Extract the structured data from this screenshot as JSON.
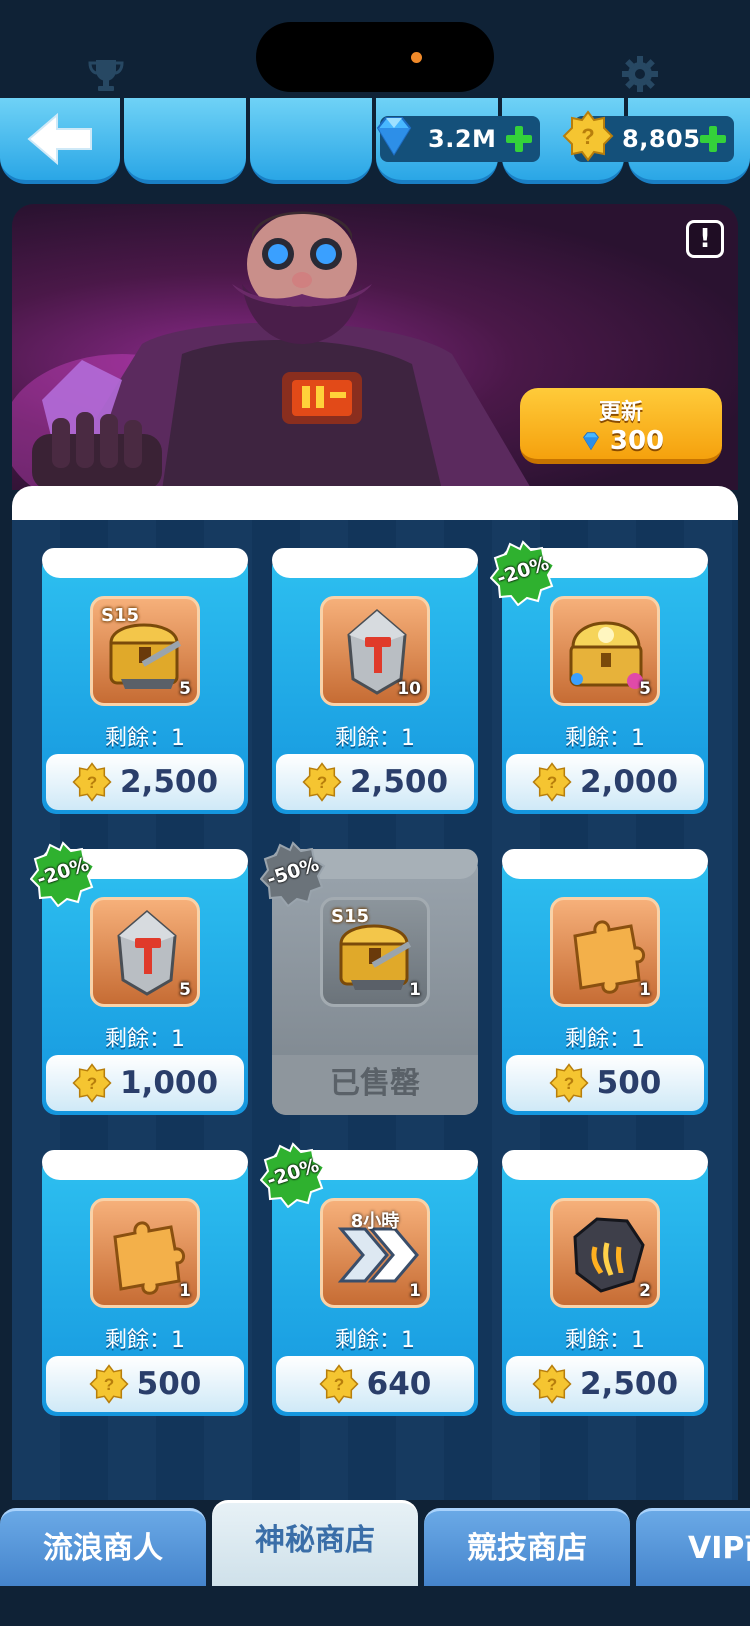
{
  "top_bar": {
    "gems": "3.2M",
    "coins": "8,805"
  },
  "banner": {
    "info_label": "!",
    "refresh_label": "更新",
    "refresh_cost": "300"
  },
  "shop_items": [
    {
      "icon": "s15-chest-icon",
      "badge": "S15",
      "qty": "5",
      "remaining": "剩餘：1",
      "price": "2,500",
      "discount": "",
      "sold_out": false
    },
    {
      "icon": "hammer-stone-icon",
      "badge": "",
      "qty": "10",
      "remaining": "剩餘：1",
      "price": "2,500",
      "discount": "",
      "sold_out": false
    },
    {
      "icon": "treasure-chest-icon",
      "badge": "",
      "qty": "5",
      "remaining": "剩餘：1",
      "price": "2,000",
      "discount": "-20%",
      "sold_out": false
    },
    {
      "icon": "hammer-stone-icon",
      "badge": "",
      "qty": "5",
      "remaining": "剩餘：1",
      "price": "1,000",
      "discount": "-20%",
      "sold_out": false
    },
    {
      "icon": "s15-chest-icon",
      "badge": "S15",
      "qty": "1",
      "remaining": "",
      "price": "",
      "discount": "-50%",
      "sold_out": true,
      "sold_label": "已售罄"
    },
    {
      "icon": "puzzle-piece-icon",
      "badge": "",
      "qty": "1",
      "remaining": "剩餘：1",
      "price": "500",
      "discount": "",
      "sold_out": false
    },
    {
      "icon": "puzzle-piece-icon",
      "badge": "",
      "qty": "1",
      "remaining": "剩餘：1",
      "price": "500",
      "discount": "",
      "sold_out": false
    },
    {
      "icon": "speedup-arrows-icon",
      "badge": "8小時",
      "qty": "1",
      "remaining": "剩餘：1",
      "price": "640",
      "discount": "-20%",
      "sold_out": false
    },
    {
      "icon": "dark-crystal-icon",
      "badge": "",
      "qty": "2",
      "remaining": "剩餘：1",
      "price": "2,500",
      "discount": "",
      "sold_out": false
    }
  ],
  "bottom_tabs": [
    {
      "label": "流浪商人",
      "active": false
    },
    {
      "label": "神秘商店",
      "active": true
    },
    {
      "label": "競技商店",
      "active": false
    },
    {
      "label": "VIP商",
      "active": false
    }
  ],
  "colors": {
    "background": "#0f2236",
    "card_blue": "#1596de",
    "price_text": "#2a3e6a",
    "discount_green": "#2fb12f",
    "refresh_orange": "#f5a10d"
  }
}
